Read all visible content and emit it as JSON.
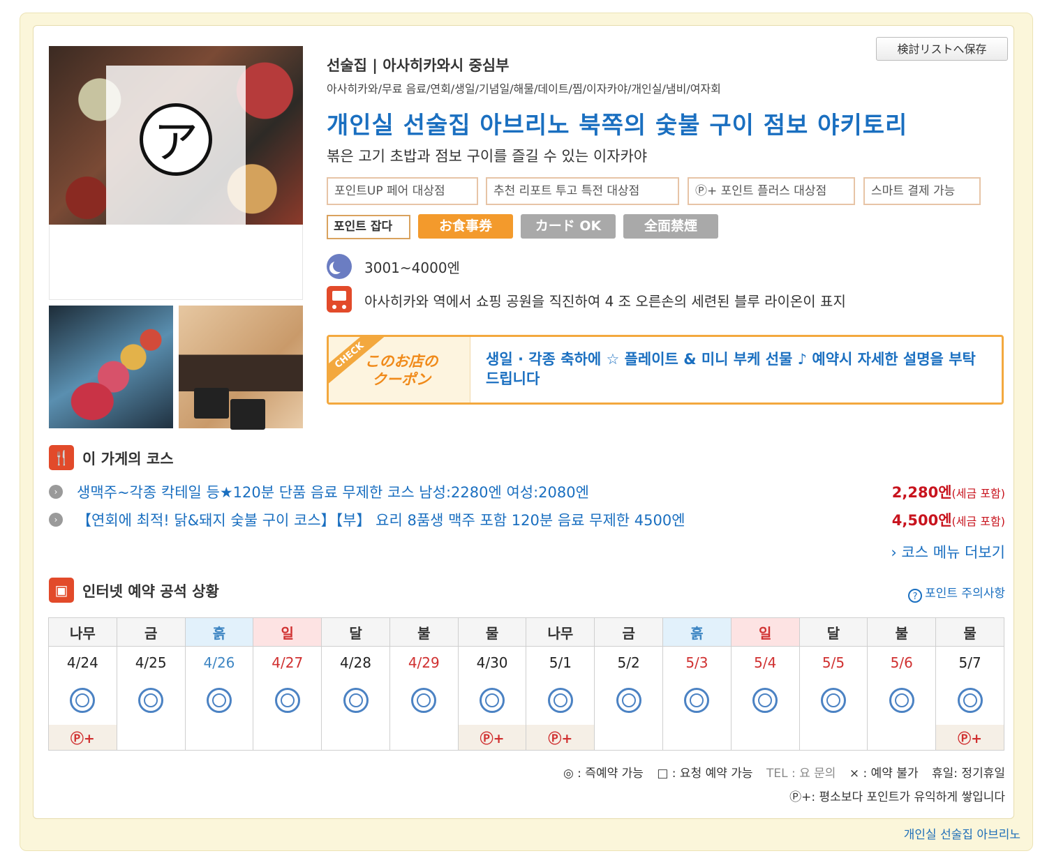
{
  "header": {
    "save_button": "検討リストへ保存",
    "genre": "선술집 | 아사히카와시 중심부",
    "tags": "아사히카와/무료 음료/연회/생일/기념일/해물/데이트/찜/이자카야/개인실/냄비/여자회",
    "shop_name": "개인실 선술집 아브리노 북쪽의 숯불 구이 점보 야키토리",
    "catch": "볶은 고기 초밥과 점보 구이를 즐길 수 있는 이자카야",
    "logo_glyph": "ア"
  },
  "badges": [
    "포인트UP 페어 대상점",
    "추천 리포트 투고 특전 대상점",
    "Ⓟ+ 포인트 플러스 대상점",
    "스마트 결제 가능"
  ],
  "pills": {
    "point": "포인트 잡다",
    "meal_ticket": "お食事券",
    "card": "カード OK",
    "smoking": "全面禁煙",
    "colors": {
      "meal_ticket": "#f39a2c",
      "card": "#a9a9a9",
      "smoking": "#a9a9a9"
    }
  },
  "info": {
    "budget": "3001~4000엔",
    "access": "아사히카와 역에서 쇼핑 공원을 직진하여 4 조 오른손의 세련된 블루 라이온이 표지",
    "budget_icon": "moon-icon",
    "access_icon": "train-icon"
  },
  "coupon": {
    "check_label": "CHECK",
    "title": "このお店の クーポン",
    "text": "생일 · 각종 축하에 ☆ 플레이트 & 미니 부케 선물 ♪ 예약시 자세한 설명을 부탁드립니다"
  },
  "courses": {
    "section_title": "이 가게의 코스",
    "items": [
      {
        "name": "생맥주~각종 칵테일 등★120분 단품 음료 무제한 코스 남성:2280엔 여성:2080엔",
        "price": "2,280엔",
        "tax": "(세금 포함)"
      },
      {
        "name": "【연회에 최적! 닭&돼지 숯불 구이 코스】【부】 요리 8품생 맥주 포함 120분 음료 무제한 4500엔",
        "price": "4,500엔",
        "tax": "(세금 포함)"
      }
    ],
    "more_link": "코스 메뉴 더보기"
  },
  "reservation": {
    "section_title": "인터넷 예약 공석 상황",
    "point_note": "포인트 주의사항",
    "days": [
      {
        "dow": "나무",
        "date": "4/24",
        "type": "weekday",
        "pplus": true
      },
      {
        "dow": "금",
        "date": "4/25",
        "type": "weekday",
        "pplus": false
      },
      {
        "dow": "흙",
        "date": "4/26",
        "type": "sat",
        "pplus": false
      },
      {
        "dow": "일",
        "date": "4/27",
        "type": "sun",
        "pplus": false
      },
      {
        "dow": "달",
        "date": "4/28",
        "type": "weekday",
        "pplus": false
      },
      {
        "dow": "불",
        "date": "4/29",
        "type": "holiday",
        "pplus": false
      },
      {
        "dow": "물",
        "date": "4/30",
        "type": "weekday",
        "pplus": true
      },
      {
        "dow": "나무",
        "date": "5/1",
        "type": "weekday",
        "pplus": true
      },
      {
        "dow": "금",
        "date": "5/2",
        "type": "weekday",
        "pplus": false
      },
      {
        "dow": "흙",
        "date": "5/3",
        "type": "sat-holiday",
        "pplus": false
      },
      {
        "dow": "일",
        "date": "5/4",
        "type": "sun",
        "pplus": false
      },
      {
        "dow": "달",
        "date": "5/5",
        "type": "holiday",
        "pplus": false
      },
      {
        "dow": "불",
        "date": "5/6",
        "type": "holiday",
        "pplus": false
      },
      {
        "dow": "물",
        "date": "5/7",
        "type": "weekday",
        "pplus": true
      }
    ],
    "pplus_label": "Ⓟ+",
    "legend": {
      "instant": "◎ : 즉예약 가능",
      "request": "□ : 요청 예약 가능",
      "tel": "TEL : 요 문의",
      "unavailable": "× : 예약 불가",
      "holiday": "휴일: 정기휴일",
      "pplus_note": "Ⓟ+: 평소보다 포인트가 유익하게 쌓입니다"
    }
  },
  "footer_link": "개인실 선술집 아브리노"
}
